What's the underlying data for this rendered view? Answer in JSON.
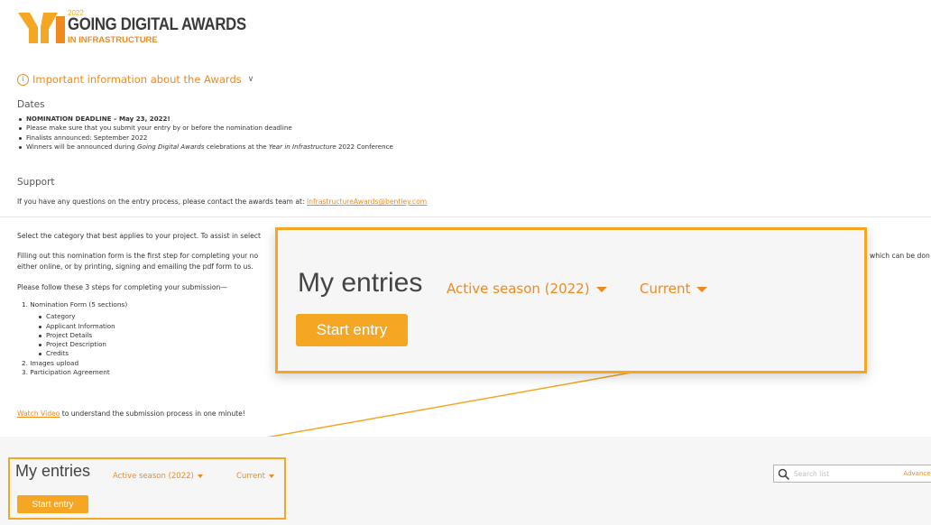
{
  "logo": {
    "year": "2022",
    "title": "GOING DIGITAL AWARDS",
    "subtitle": "IN INFRASTRUCTURE"
  },
  "info": {
    "label": "Important information about the Awards"
  },
  "dates": {
    "heading": "Dates",
    "deadline": "NOMINATION DEADLINE – May 23, 2022!",
    "items": [
      "Please make sure that you submit your entry by or before the nomination deadline",
      "Finalists announced: September 2022"
    ],
    "winners_pre": "Winners will be announced during ",
    "winners_em1": "Going Digital Awards",
    "winners_mid": " celebrations at the ",
    "winners_em2": "Year in Infrastructure",
    "winners_post": " 2022 Conference"
  },
  "support": {
    "heading": "Support",
    "text": "If you have any questions on the entry process, please contact the awards team at: ",
    "email": "InfrastructureAwards@bentley.com"
  },
  "body": {
    "select_text": "Select the category that best applies to your project. To assist in select",
    "filling_text": "Filling out this nomination form is the first step for completing your no",
    "filling_right": "which can be don",
    "either_text": "either online, or by printing, signing and emailing the pdf form to us.",
    "follow_text": "Please follow these 3 steps for completing your submission—",
    "step1": "1. Nomination Form (5 sections)",
    "step1_items": [
      "Category",
      "Applicant Information",
      "Project Details",
      "Project Description",
      "Credits"
    ],
    "step2": "2. Images upload",
    "step3": "3. Participation Agreement",
    "video_link": "Watch Video",
    "video_text": " to understand the submission process in one minute!"
  },
  "entries": {
    "title": "My entries",
    "season": "Active season (2022)",
    "filter": "Current",
    "start_button": "Start entry",
    "search_placeholder": "Search list",
    "advanced": "Advanced"
  },
  "colors": {
    "accent": "#f5a623",
    "link": "#f08a1c"
  }
}
